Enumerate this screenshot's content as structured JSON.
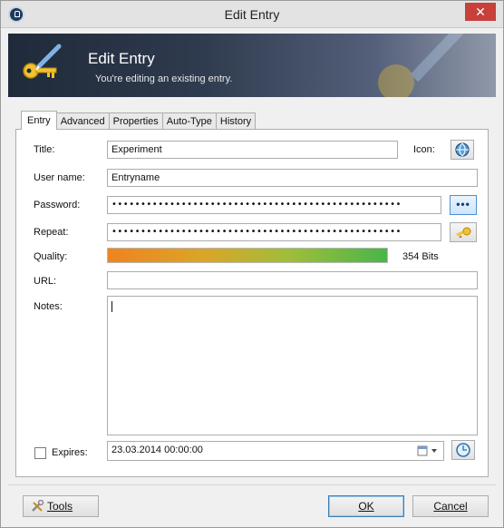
{
  "window": {
    "title": "Edit Entry",
    "close_glyph": "✕"
  },
  "banner": {
    "title": "Edit Entry",
    "subtitle": "You're editing an existing entry."
  },
  "tabs": [
    {
      "label": "Entry",
      "active": true
    },
    {
      "label": "Advanced",
      "active": false
    },
    {
      "label": "Properties",
      "active": false
    },
    {
      "label": "Auto-Type",
      "active": false
    },
    {
      "label": "History",
      "active": false
    }
  ],
  "form": {
    "title_label": "Title:",
    "title_value": "Experiment",
    "icon_label": "Icon:",
    "username_label": "User name:",
    "username_value": "Entryname",
    "password_label": "Password:",
    "password_value": "••••••••••••••••••••••••••••••••••••••••••••••••••",
    "show_password_glyph": "•••",
    "repeat_label": "Repeat:",
    "repeat_value": "••••••••••••••••••••••••••••••••••••••••••••••••••",
    "quality_label": "Quality:",
    "quality_bits": "354 Bits",
    "url_label": "URL:",
    "url_value": "",
    "notes_label": "Notes:",
    "notes_value": "",
    "expires_label": "Expires:",
    "expires_checked": false,
    "expires_value": "23.03.2014 00:00:00"
  },
  "buttons": {
    "tools": "Tools",
    "ok": "OK",
    "cancel": "Cancel"
  },
  "colors": {
    "accent": "#3c7fb1",
    "close": "#c7403a",
    "quality_start": "#f0831f",
    "quality_end": "#49b54a"
  }
}
